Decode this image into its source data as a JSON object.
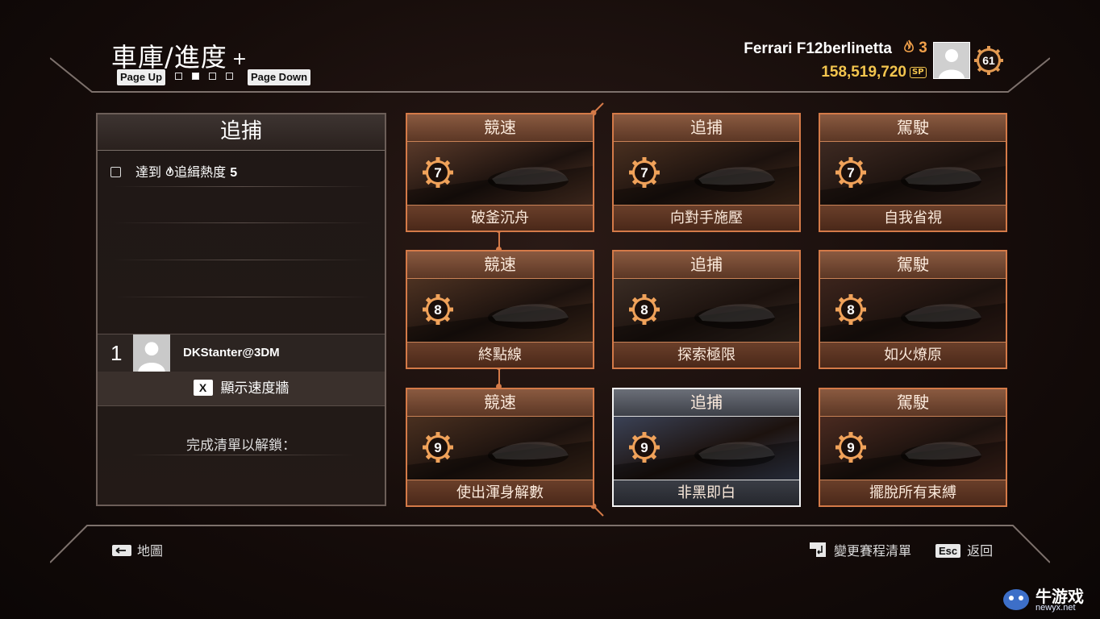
{
  "header": {
    "title": "車庫/進度",
    "plus": "+",
    "page_up": "Page Up",
    "page_down": "Page Down",
    "page_count": 4,
    "page_active": 2,
    "car_name": "Ferrari F12berlinetta",
    "heat_level": "3",
    "speed_points": "158,519,720",
    "sp_label": "SP",
    "player_level": "61"
  },
  "panel": {
    "title": "追捕",
    "task": {
      "prefix": "達到",
      "label": "追緝熱度",
      "value": "5"
    },
    "leaderboard": {
      "rank": "1",
      "name": "DKStanter@3DM"
    },
    "wall_key": "X",
    "wall_label": "顯示速度牆",
    "unlock_text": "完成清單以解鎖："
  },
  "cards": [
    {
      "category": "競速",
      "level": "7",
      "name": "破釜沉舟",
      "selected": false
    },
    {
      "category": "追捕",
      "level": "7",
      "name": "向對手施壓",
      "selected": false
    },
    {
      "category": "駕駛",
      "level": "7",
      "name": "自我省視",
      "selected": false
    },
    {
      "category": "競速",
      "level": "8",
      "name": "終點線",
      "selected": false
    },
    {
      "category": "追捕",
      "level": "8",
      "name": "探索極限",
      "selected": false
    },
    {
      "category": "駕駛",
      "level": "8",
      "name": "如火燎原",
      "selected": false
    },
    {
      "category": "競速",
      "level": "9",
      "name": "使出渾身解數",
      "selected": false
    },
    {
      "category": "追捕",
      "level": "9",
      "name": "非黑即白",
      "selected": true
    },
    {
      "category": "駕駛",
      "level": "9",
      "name": "擺脫所有束縛",
      "selected": false
    }
  ],
  "footer": {
    "map_label": "地圖",
    "change_label": "變更賽程清單",
    "esc_key": "Esc",
    "back_label": "返回"
  },
  "watermark": {
    "text": "牛游戏",
    "url": "newyx.net"
  },
  "colors": {
    "accent": "#d47a48",
    "money": "#f3c54e",
    "heat": "#f0a04a",
    "selected": "#f4f4f4"
  },
  "icons": {
    "heat": "flame-icon",
    "avatar": "user-silhouette-icon",
    "level": "gear-badge-icon",
    "map": "arrow-key-icon",
    "change": "return-key-icon"
  }
}
